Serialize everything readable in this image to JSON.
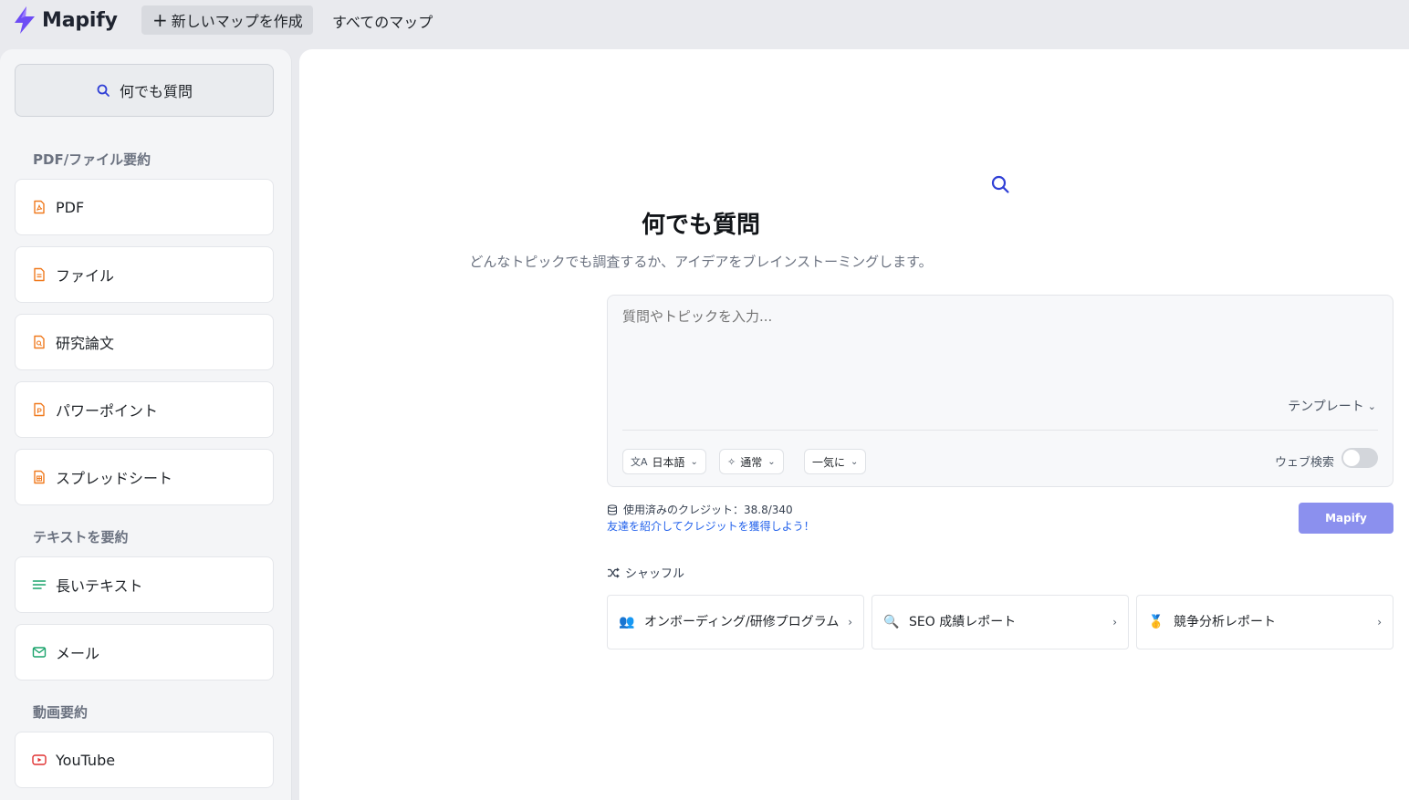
{
  "app": {
    "name": "Mapify"
  },
  "topbar": {
    "new_map_label": "新しいマップを作成",
    "all_maps_label": "すべてのマップ"
  },
  "sidebar": {
    "ask_label": "何でも質問",
    "sections": [
      {
        "label": "PDF/ファイル要約"
      },
      {
        "label": "テキストを要約"
      },
      {
        "label": "動画要約"
      }
    ],
    "items": [
      {
        "label": "PDF",
        "icon": "pdf-file-icon"
      },
      {
        "label": "ファイル",
        "icon": "file-icon"
      },
      {
        "label": "研究論文",
        "icon": "research-paper-icon"
      },
      {
        "label": "パワーポイント",
        "icon": "powerpoint-icon"
      },
      {
        "label": "スプレッドシート",
        "icon": "spreadsheet-icon"
      },
      {
        "label": "長いテキスト",
        "icon": "long-text-icon"
      },
      {
        "label": "メール",
        "icon": "mail-icon"
      },
      {
        "label": "YouTube",
        "icon": "youtube-icon"
      }
    ]
  },
  "main": {
    "title": "何でも質問",
    "subtitle": "どんなトピックでも調査するか、アイデアをブレインストーミングします。",
    "input": {
      "placeholder": "質問やトピックを入力...",
      "template_label": "テンプレート",
      "language": "日本語",
      "mode": "通常",
      "generation": "一気に",
      "web_search_label": "ウェブ検索",
      "web_search_enabled": false
    },
    "credits_text": "使用済みのクレジット：38.8/340",
    "referral_text": "友達を紹介してクレジットを獲得しよう！",
    "submit_label": "Mapify",
    "shuffle_label": "シャッフル",
    "suggestions": [
      {
        "emoji": "👥",
        "label": "オンボーディング/研修プログラム"
      },
      {
        "emoji": "🔍",
        "label": "SEO 成績レポート"
      },
      {
        "emoji": "🥇",
        "label": "競争分析レポート"
      }
    ]
  },
  "colors": {
    "accent": "#8b90ee",
    "logo_purple": "#6d4cf5",
    "icon_blue": "#2f3fd6",
    "file_orange": "#f07a1f",
    "text_green": "#1aa36b",
    "youtube_red": "#e03131",
    "link_blue": "#2563eb"
  }
}
